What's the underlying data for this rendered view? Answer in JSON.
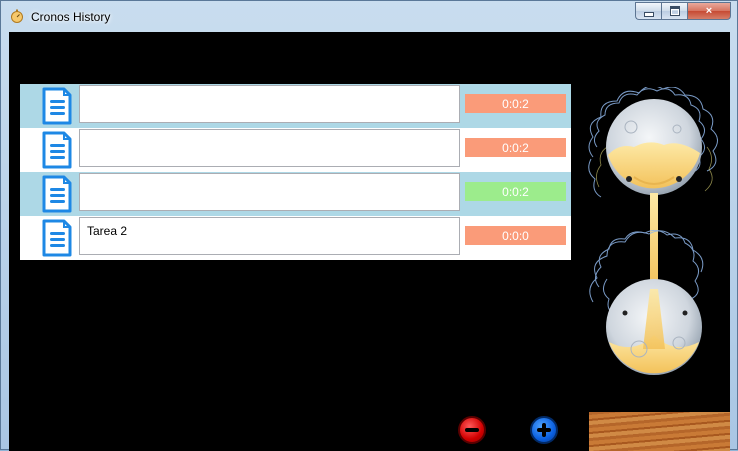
{
  "window": {
    "title": "Cronos History",
    "controls": {
      "minimize": "minimize",
      "maximize": "maximize",
      "close": "×"
    }
  },
  "tasks": [
    {
      "name": "",
      "time": "0:0:2",
      "state": "paused",
      "color": "#fa9b79"
    },
    {
      "name": "",
      "time": "0:0:2",
      "state": "paused",
      "color": "#fa9b79"
    },
    {
      "name": "",
      "time": "0:0:2",
      "state": "running",
      "color": "#9cec8c"
    },
    {
      "name": "Tarea 2",
      "time": "0:0:0",
      "state": "paused",
      "color": "#fa9b79"
    }
  ],
  "buttons": {
    "remove": {
      "icon": "minus-circle-icon",
      "color": "#d10000"
    },
    "add": {
      "icon": "plus-circle-icon",
      "color": "#0a5fe0"
    }
  },
  "colors": {
    "row_alt": "#add8e6",
    "row_plain": "#ffffff",
    "background": "#000000",
    "accent_note_icon": "#1e88e5"
  }
}
